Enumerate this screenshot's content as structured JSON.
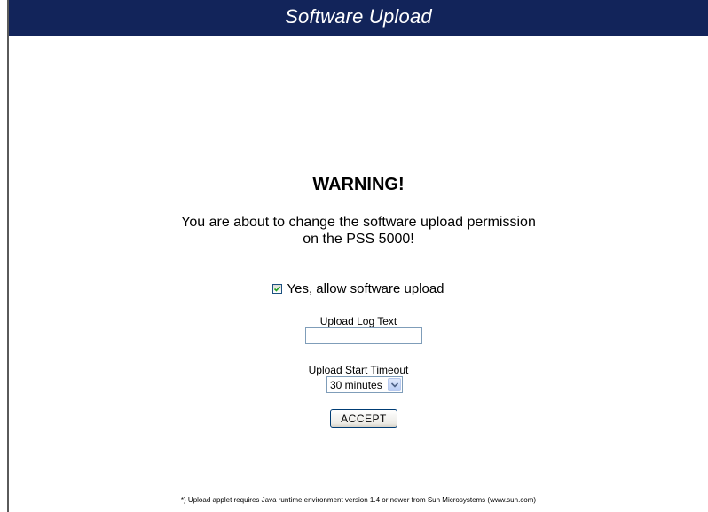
{
  "header": {
    "title": "Software Upload"
  },
  "warning": {
    "title": "WARNING!",
    "line1": "You are about to change the software upload permission",
    "line2": "on the PSS 5000!"
  },
  "form": {
    "allow_upload": {
      "label": "Yes, allow software upload",
      "checked": true
    },
    "log_text": {
      "label": "Upload Log Text",
      "value": ""
    },
    "timeout": {
      "label": "Upload Start Timeout",
      "selected": "30 minutes"
    },
    "accept_label": "ACCEPT"
  },
  "footnote": "*) Upload applet requires Java runtime environment version 1.4 or newer from Sun Microsystems (www.sun.com)",
  "colors": {
    "header_bg": "#12245a",
    "header_text": "#ffffff",
    "input_border": "#7f9db9",
    "button_border": "#003c74"
  }
}
